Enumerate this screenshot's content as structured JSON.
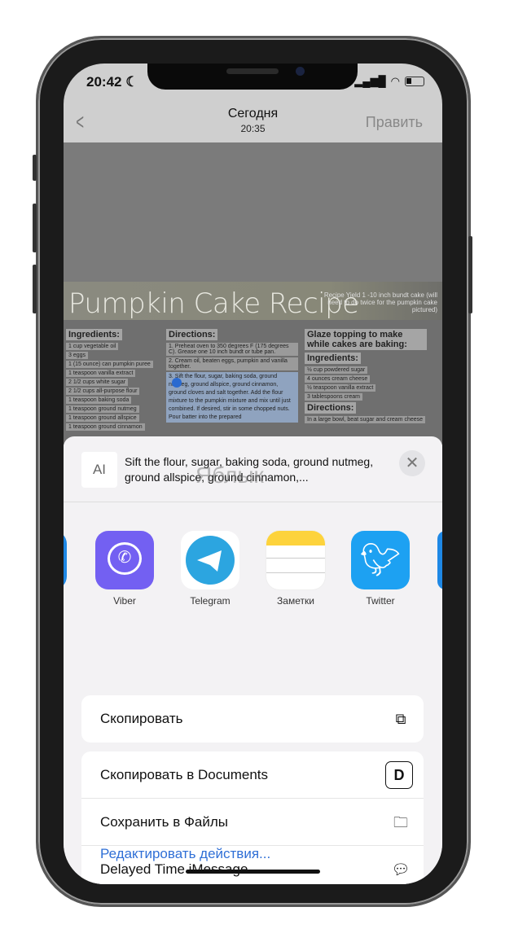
{
  "status": {
    "time": "20:42"
  },
  "nav": {
    "title": "Сегодня",
    "subtitle": "20:35",
    "edit": "Править"
  },
  "recipe": {
    "title": "Pumpkin Cake Recipe",
    "yield": "Recipe Yield 1 -10 inch bundt cake (will need to do twice for the pumpkin cake pictured)",
    "ingredients_h": "Ingredients:",
    "ingredients": [
      "1 cup vegetable oil",
      "3 eggs",
      "1 (15 ounce) can pumpkin puree",
      "1 teaspoon vanilla extract",
      "2 1/2 cups white sugar",
      "2 1/2 cups all-purpose flour",
      "1 teaspoon baking soda",
      "1 teaspoon ground nutmeg",
      "1 teaspoon ground allspice",
      "1 teaspoon ground cinnamon"
    ],
    "directions_h": "Directions:",
    "directions": [
      "1. Preheat oven to 350 degrees F (175 degrees C). Grease one 10 inch bundt or tube pan.",
      "2. Cream oil, beaten eggs, pumpkin and vanilla together.",
      "3. Sift the flour, sugar, baking soda, ground nutmeg, ground allspice, ground cinnamon, ground cloves and salt together. Add the flour mixture to the pumpkin mixture and mix until just combined. If desired, stir in some chopped nuts. Pour batter into the prepared"
    ],
    "glaze_h": "Glaze topping to make while cakes are baking:",
    "glaze_ing_h": "Ingredients:",
    "glaze_ing": [
      "½ cup powdered sugar",
      "4 ounces cream cheese",
      "½ teaspoon vanilla extract",
      "3 tablespoons cream"
    ],
    "glaze_dir_h": "Directions:",
    "glaze_dir": "In a large bowl, beat sugar and cream cheese"
  },
  "share": {
    "preview_icon": "AI",
    "preview_text": "Sift the flour, sugar, baking soda, ground nutmeg, ground allspice, ground cinnamon,...",
    "watermark": "Яблык",
    "apps": [
      {
        "label": "Viber",
        "color": "#7360f2"
      },
      {
        "label": "Telegram",
        "color": "#2ca5e0"
      },
      {
        "label": "Заметки",
        "color": "#fdd33c"
      },
      {
        "label": "Twitter",
        "color": "#1da1f2"
      }
    ],
    "copy": "Скопировать",
    "actions": [
      "Скопировать в Documents",
      "Сохранить в Файлы",
      "Delayed Time iMessage"
    ],
    "edit_actions": "Редактировать действия..."
  }
}
